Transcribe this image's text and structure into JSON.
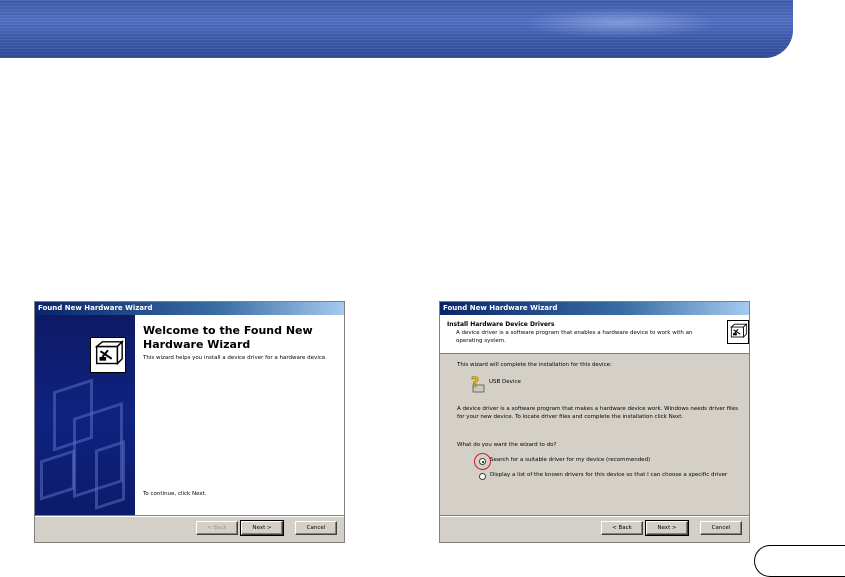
{
  "dialog1": {
    "title": "Found New Hardware Wizard",
    "heading": "Welcome to the Found New Hardware Wizard",
    "description": "This wizard helps you install a device driver for a hardware device.",
    "continue_text": "To continue, click Next.",
    "buttons": {
      "back": "< Back",
      "next": "Next >",
      "cancel": "Cancel"
    }
  },
  "dialog2": {
    "title": "Found New Hardware Wizard",
    "header_title": "Install Hardware Device Drivers",
    "header_subtitle": "A device driver is a software program that enables a hardware device to work with an operating system.",
    "intro": "This wizard will complete the installation for this device:",
    "device_name": "USB Device",
    "explanation": "A device driver is a software program that makes a hardware device work. Windows needs driver files for your new device. To locate driver files and complete the installation click Next.",
    "question": "What do you want the wizard to do?",
    "options": [
      {
        "label": "Search for a suitable driver for my device (recommended)",
        "selected": true
      },
      {
        "label": "Display a list of the known drivers for this device so that I can choose a specific driver",
        "selected": false
      }
    ],
    "buttons": {
      "back": "< Back",
      "next": "Next >",
      "cancel": "Cancel"
    }
  },
  "colors": {
    "banner": "#3d5aa8",
    "titlebar": "#0a246a",
    "dialog_face": "#d4d0c8",
    "side_panel": "#0f2280",
    "highlight_circle": "#c8202a"
  },
  "icons": {
    "wizard": "hardware-wizard-icon",
    "device": "question-device-icon"
  }
}
